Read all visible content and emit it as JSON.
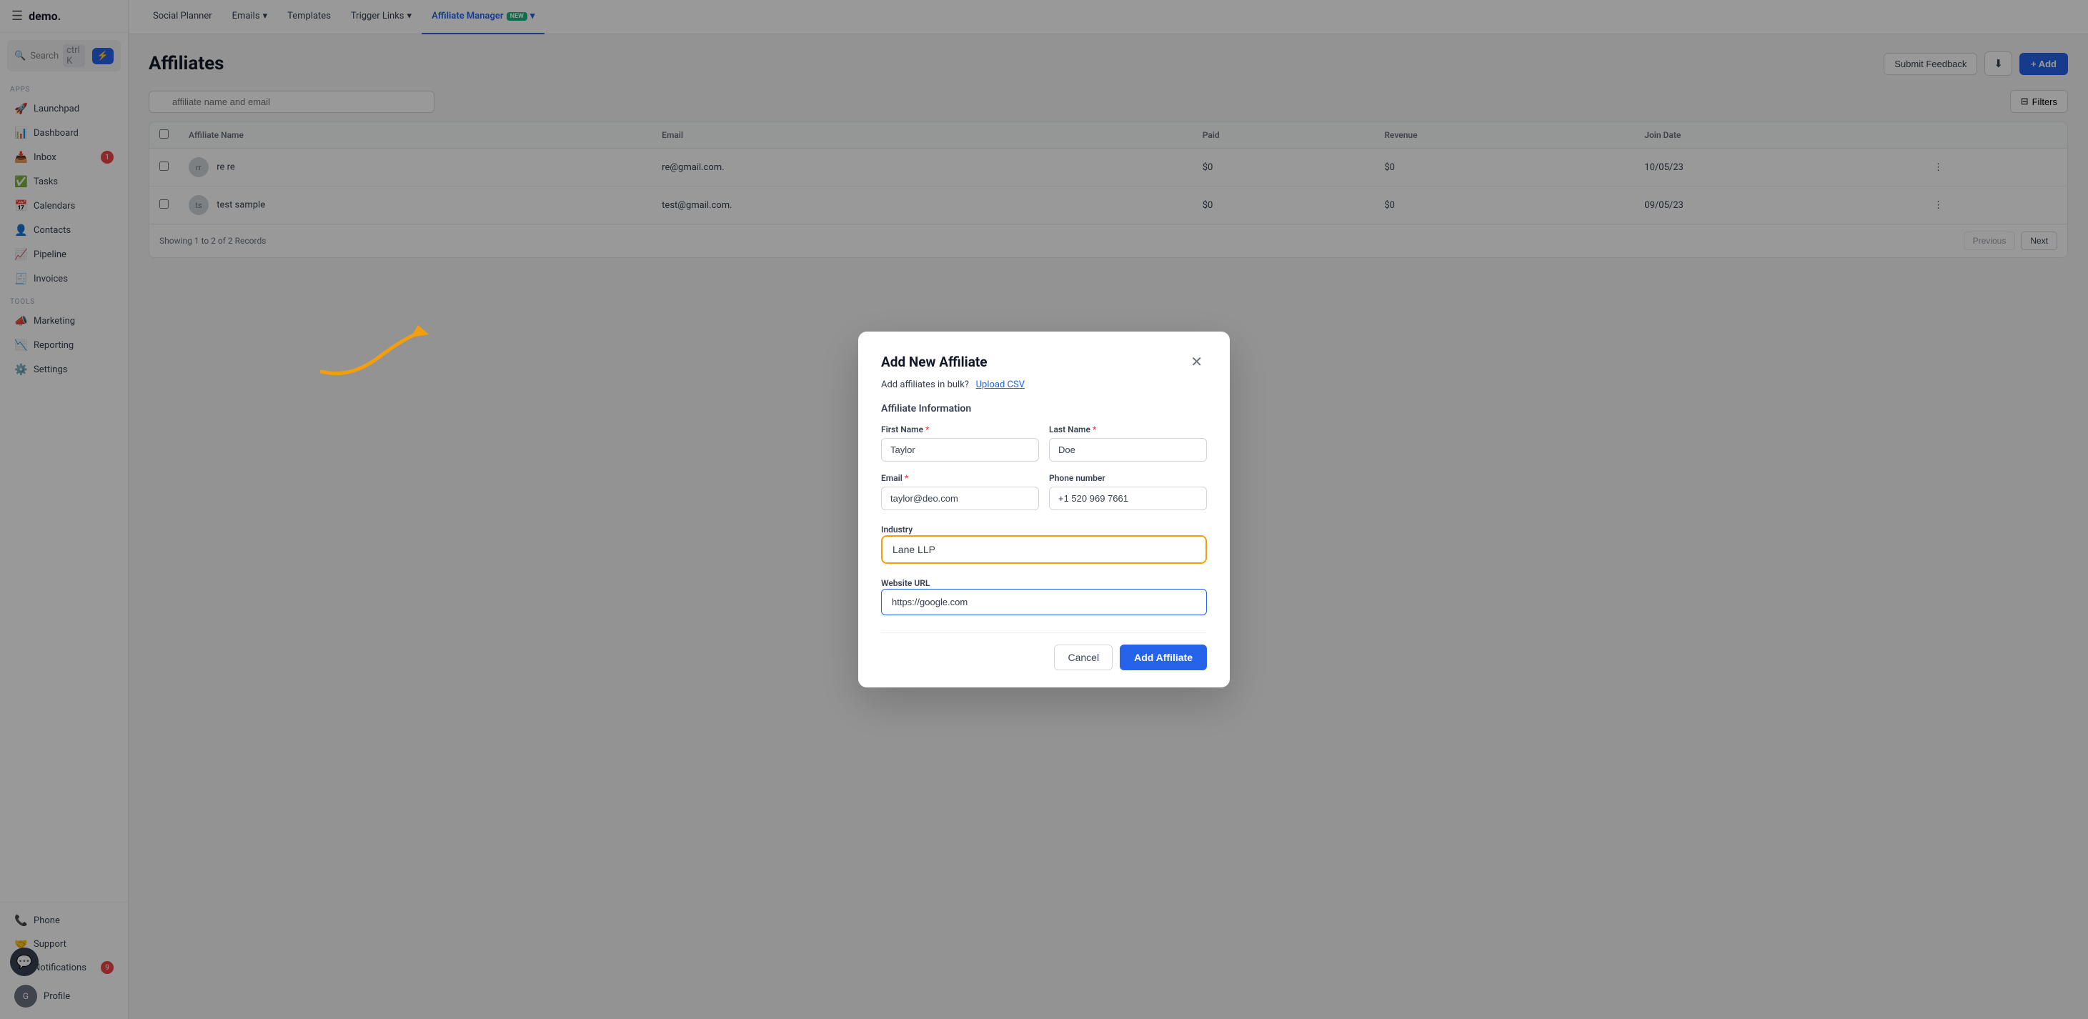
{
  "app": {
    "logo": "demo.",
    "menu_icon": "☰"
  },
  "sidebar": {
    "search_label": "Search",
    "search_shortcut": "ctrl K",
    "lightning_icon": "⚡",
    "section_apps": "Apps",
    "section_tools": "Tools",
    "items_apps": [
      {
        "id": "launchpad",
        "icon": "🚀",
        "label": "Launchpad"
      },
      {
        "id": "dashboard",
        "icon": "📊",
        "label": "Dashboard"
      },
      {
        "id": "inbox",
        "icon": "📥",
        "label": "Inbox",
        "badge": 1
      },
      {
        "id": "tasks",
        "icon": "✅",
        "label": "Tasks"
      },
      {
        "id": "calendars",
        "icon": "📅",
        "label": "Calendars"
      },
      {
        "id": "contacts",
        "icon": "👤",
        "label": "Contacts"
      },
      {
        "id": "pipeline",
        "icon": "📈",
        "label": "Pipeline"
      },
      {
        "id": "invoices",
        "icon": "🧾",
        "label": "Invoices"
      }
    ],
    "items_tools": [
      {
        "id": "marketing",
        "icon": "📣",
        "label": "Marketing"
      },
      {
        "id": "reporting",
        "icon": "📉",
        "label": "Reporting"
      },
      {
        "id": "settings",
        "icon": "⚙️",
        "label": "Settings"
      }
    ],
    "bottom_items": [
      {
        "id": "phone",
        "icon": "📞",
        "label": "Phone"
      },
      {
        "id": "support",
        "icon": "🤝",
        "label": "Support"
      },
      {
        "id": "notifications",
        "icon": "🔔",
        "label": "Notifications",
        "badge": 9
      },
      {
        "id": "profile",
        "icon": "👤",
        "label": "Profile"
      }
    ]
  },
  "topnav": {
    "items": [
      {
        "id": "social-planner",
        "label": "Social Planner",
        "active": false
      },
      {
        "id": "emails",
        "label": "Emails",
        "dropdown": true,
        "active": false
      },
      {
        "id": "templates",
        "label": "Templates",
        "active": false
      },
      {
        "id": "trigger-links",
        "label": "Trigger Links",
        "dropdown": true,
        "active": false
      },
      {
        "id": "affiliate-manager",
        "label": "Affiliate Manager",
        "active": true,
        "new_badge": "new",
        "dropdown": true
      }
    ]
  },
  "page": {
    "title": "Affiliates",
    "feedback_btn": "Submit Feedback",
    "download_icon": "⬇",
    "add_btn": "+ Add"
  },
  "table": {
    "search_placeholder": "affiliate name and email",
    "filter_btn": "Filters",
    "filter_icon": "⊟",
    "columns": [
      "Affiliate Name",
      "Email",
      "",
      "Paid",
      "Revenue",
      "Join Date",
      ""
    ],
    "rows": [
      {
        "id": 1,
        "name": "re re",
        "email": "re@gmail.com.",
        "paid": "$0",
        "revenue": "$0",
        "join_date": "10/05/23"
      },
      {
        "id": 2,
        "name": "test sample",
        "email": "test@gmail.com.",
        "paid": "$0",
        "revenue": "$0",
        "join_date": "09/05/23"
      }
    ],
    "footer_text": "Showing 1 to 2 of 2 Records",
    "prev_btn": "Previous",
    "next_btn": "Next"
  },
  "modal": {
    "title": "Add New Affiliate",
    "bulk_label": "Add affiliates in bulk?",
    "upload_csv": "Upload CSV",
    "section_label": "Affiliate Information",
    "first_name_label": "First Name",
    "first_name_required": "*",
    "first_name_value": "Taylor",
    "last_name_label": "Last Name",
    "last_name_required": "*",
    "last_name_value": "Doe",
    "email_label": "Email",
    "email_required": "*",
    "email_value": "taylor@deo.com",
    "phone_label": "Phone number",
    "phone_value": "+1 520 969 7661",
    "industry_label": "Industry",
    "industry_value": "Lane LLP",
    "website_label": "Website URL",
    "website_value": "https://google.com",
    "cancel_btn": "Cancel",
    "add_affiliate_btn": "Add Affiliate"
  }
}
